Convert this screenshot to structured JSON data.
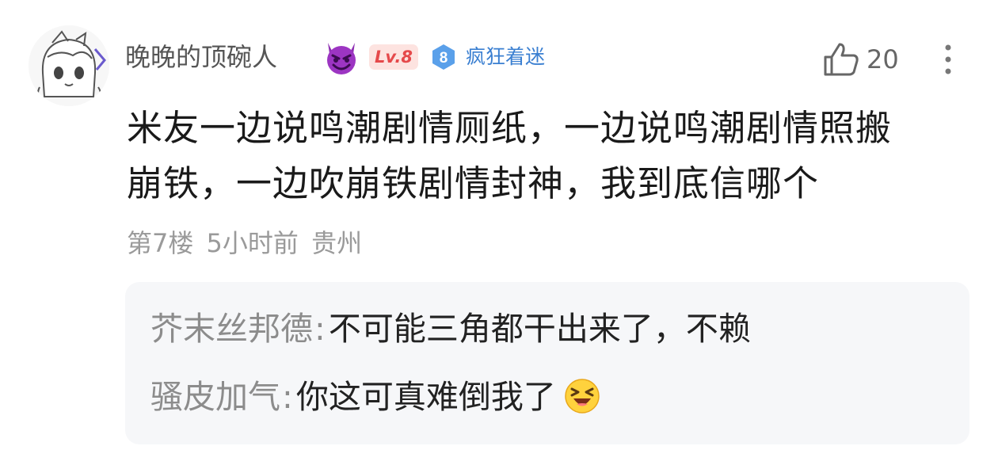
{
  "comment": {
    "username": "晚晚的顶碗人",
    "level_badge": "Lv.8",
    "fan_badge": {
      "level": "8",
      "label": "疯狂着迷"
    },
    "like_count": "20",
    "content_lines": [
      "米友一边说鸣潮剧情厕纸，一边说鸣潮剧情照搬",
      "崩铁，一边吹崩铁剧情封神，我到底信哪个"
    ],
    "meta": "第7楼 5小时前 贵州"
  },
  "replies": [
    {
      "name": "芥末丝邦德",
      "colon": ":",
      "text": "不可能三角都干出来了，不赖"
    },
    {
      "name": "骚皮加气",
      "colon": ":",
      "text": "你这可真难倒我了",
      "emoji": "grinning-squint-emoji"
    }
  ],
  "icons": {
    "avatar": "anime-girl-avatar",
    "vip": "devil-face-icon",
    "like": "thumbs-up-icon",
    "more": "more-vertical-icon"
  },
  "colors": {
    "level_badge": "#e5494b",
    "fan_badge": "#3a7fd1",
    "reply_background": "#f6f7f9"
  }
}
